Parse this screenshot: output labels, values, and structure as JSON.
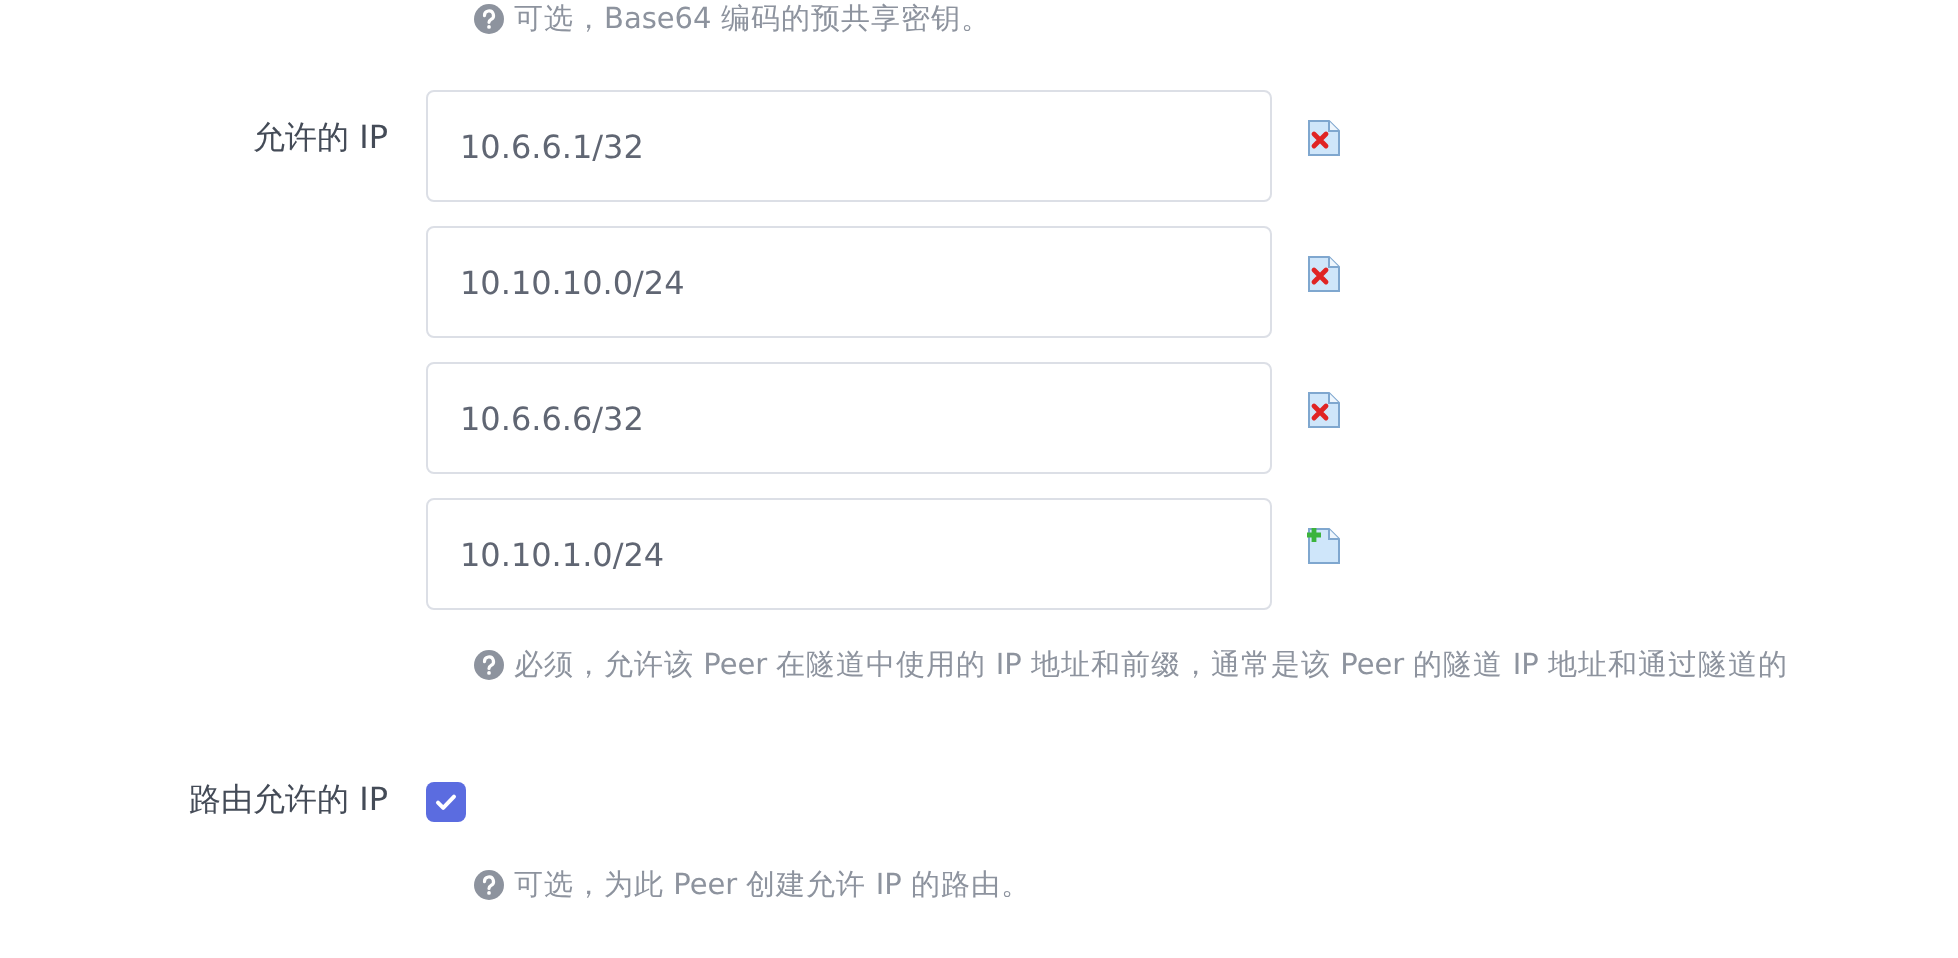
{
  "preshared_key_help": {
    "text": "可选，Base64 编码的预共享密钥。"
  },
  "allowed_ips": {
    "label": "允许的 IP",
    "entries": [
      {
        "value": "10.6.6.1/32",
        "kind": "remove"
      },
      {
        "value": "10.10.10.0/24",
        "kind": "remove"
      },
      {
        "value": "10.6.6.6/32",
        "kind": "remove"
      },
      {
        "value": "10.10.1.0/24",
        "kind": "add"
      }
    ],
    "help": "必须，允许该 Peer 在隧道中使用的 IP 地址和前缀，通常是该 Peer 的隧道 IP 地址和通过隧道的"
  },
  "route_allowed_ips": {
    "label": "路由允许的 IP",
    "checked": true,
    "help": "可选，为此 Peer 创建允许 IP 的路由。"
  }
}
